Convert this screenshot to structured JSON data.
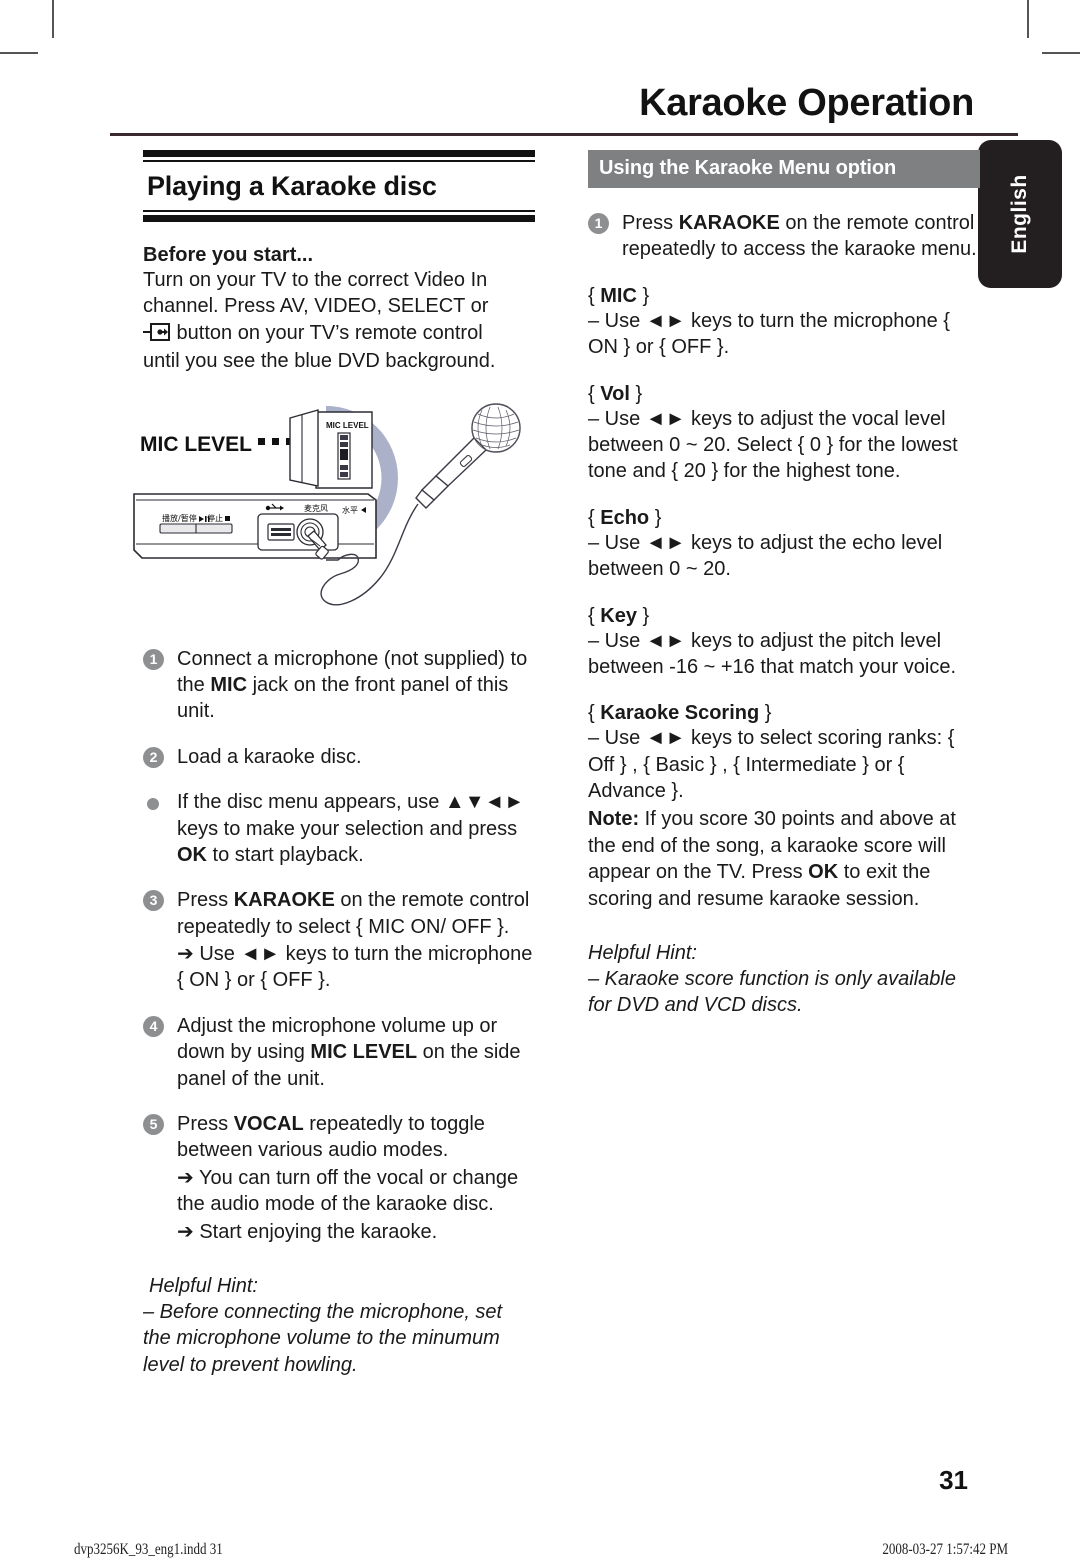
{
  "page": {
    "title": "Karaoke Operation",
    "language_tab": "English",
    "page_number": "31",
    "footer_left": "dvp3256K_93_eng1.indd   31",
    "footer_right": "2008-03-27   1:57:42 PM",
    "accent_colors": {
      "rule": "#3a2a2e",
      "bar_gray": "#7f8082",
      "bullet_gray": "#8e8f91",
      "tab_dark": "#231f20",
      "illustration_blue": "#aab1c8"
    }
  },
  "left": {
    "heading": "Playing a Karaoke disc",
    "before_you_start": {
      "title": "Before you start...",
      "line1": "Turn on your TV to the correct Video In",
      "line2": "channel. Press AV, VIDEO, SELECT or",
      "line3_after_icon": " button on your TV’s remote control",
      "line4": "until you see the blue DVD background."
    },
    "illustration": {
      "callout_label": "MIC LEVEL",
      "panel_label": "MIC LEVEL",
      "cn_play_pause": "播放/暂停",
      "cn_stop": "停止",
      "cn_mic": "麦克风",
      "cn_level": "水平",
      "usb_label": "USB"
    },
    "steps": [
      {
        "num": "1",
        "type": "number",
        "text_parts": [
          "Connect a microphone (not supplied) to the ",
          "MIC",
          " jack on the front panel of this unit."
        ]
      },
      {
        "num": "2",
        "type": "number",
        "text_parts": [
          "Load a karaoke disc.",
          "",
          ""
        ]
      },
      {
        "num": "",
        "type": "bullet",
        "text_parts": [
          "If the disc menu appears, use ▲▼◄► keys to make your selection and press ",
          "OK",
          " to start playback."
        ]
      },
      {
        "num": "3",
        "type": "number",
        "text_parts": [
          "Press ",
          "KARAOKE",
          " on the remote control repeatedly to select { MIC ON/ OFF }."
        ],
        "sub": [
          "➔ Use ◄► keys to turn the microphone { ON } or { OFF }."
        ]
      },
      {
        "num": "4",
        "type": "number",
        "text_parts": [
          "Adjust the microphone volume up or down by using ",
          "MIC LEVEL",
          " on the side panel of the unit."
        ]
      },
      {
        "num": "5",
        "type": "number",
        "text_parts": [
          "Press ",
          "VOCAL",
          " repeatedly to toggle between various audio modes."
        ],
        "sub": [
          "➔ You can turn off the vocal or change the audio mode of the karaoke disc.",
          "➔ Start enjoying the karaoke."
        ]
      }
    ],
    "hint": {
      "title": "Helpful Hint:",
      "body": "–  Before connecting the microphone, set the microphone volume to the minumum level to prevent howling."
    }
  },
  "right": {
    "bar_heading": "Using the Karaoke Menu option",
    "step1": {
      "num": "1",
      "parts": [
        "Press ",
        "KARAOKE",
        " on the remote control repeatedly to access the karaoke menu."
      ]
    },
    "options": [
      {
        "name": "MIC",
        "body": "– Use ◄► keys to turn the microphone { ON } or { OFF }."
      },
      {
        "name": "Vol",
        "body": "– Use ◄► keys to adjust the vocal level between 0 ~ 20. Select { 0 } for the lowest tone and { 20 } for the highest tone."
      },
      {
        "name": "Echo",
        "body": "– Use ◄► keys to adjust the echo level between 0 ~ 20."
      },
      {
        "name": "Key",
        "body": "– Use ◄► keys to adjust the pitch level between -16 ~ +16 that match your voice."
      },
      {
        "name": "Karaoke Scoring",
        "body": "– Use ◄► keys to select scoring ranks: { Off } ,  { Basic } , { Intermediate } or { Advance }."
      }
    ],
    "note": {
      "label": "Note:",
      "part1": " If you score 30 points and above at the end of the song, a karaoke score will appear on the TV. Press ",
      "bold2": "OK",
      "part2": " to exit the scoring and resume karaoke session."
    },
    "hint": {
      "title": "Helpful Hint:",
      "body": "–   Karaoke score function is only available for DVD and VCD discs."
    }
  }
}
